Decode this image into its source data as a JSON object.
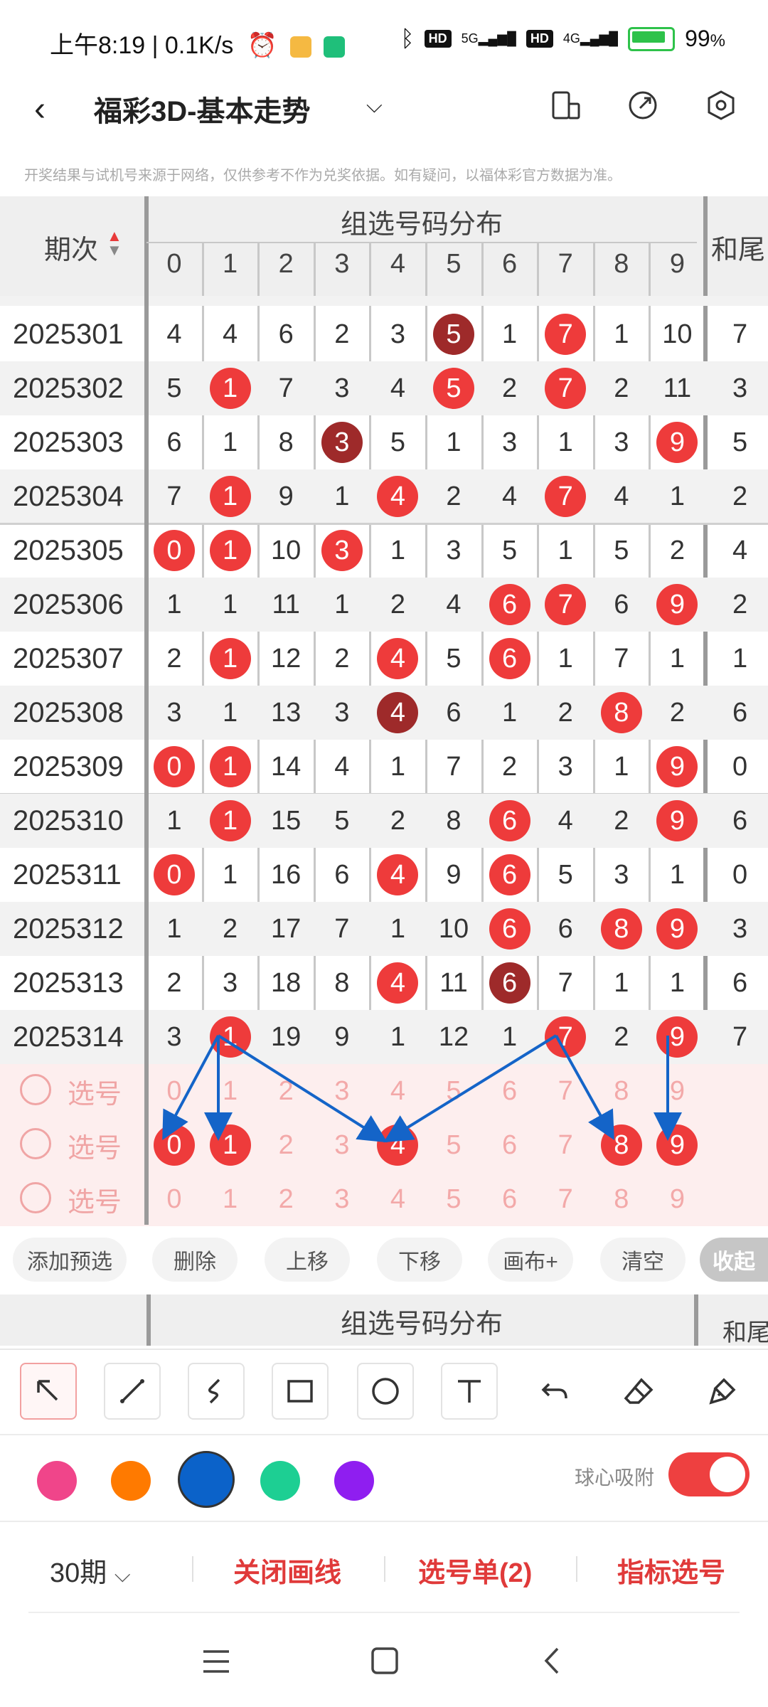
{
  "status_bar": {
    "time": "上午8:19",
    "net_speed": "0.1K/s",
    "hd1": "HD",
    "net1": "5G",
    "hd2": "HD",
    "net2": "4G",
    "battery": "99",
    "battery_unit": "%"
  },
  "header": {
    "title": "福彩3D-基本走势"
  },
  "notice": "开奖结果与试机号来源于网络，仅供参考不作为兑奖依据。如有疑问，以福体彩官方数据为准。",
  "table": {
    "period_header": "期次",
    "group_header": "组选号码分布",
    "sum_header": "和尾",
    "digits": [
      "0",
      "1",
      "2",
      "3",
      "4",
      "5",
      "6",
      "7",
      "8",
      "9"
    ],
    "rows": [
      {
        "period": "2025301",
        "cells": [
          "4",
          "4",
          "6",
          "2",
          "3",
          "5",
          "1",
          "7",
          "1",
          "10"
        ],
        "balls": [
          5,
          7
        ],
        "dark": [
          5
        ],
        "sum": "7"
      },
      {
        "period": "2025302",
        "cells": [
          "5",
          "1",
          "7",
          "3",
          "4",
          "5",
          "2",
          "7",
          "2",
          "11"
        ],
        "balls": [
          1,
          5,
          7
        ],
        "dark": [],
        "sum": "3"
      },
      {
        "period": "2025303",
        "cells": [
          "6",
          "1",
          "8",
          "3",
          "5",
          "1",
          "3",
          "1",
          "3",
          "9"
        ],
        "balls": [
          3,
          9
        ],
        "dark": [
          3
        ],
        "sum": "5"
      },
      {
        "period": "2025304",
        "cells": [
          "7",
          "1",
          "9",
          "1",
          "4",
          "2",
          "4",
          "7",
          "4",
          "1"
        ],
        "balls": [
          1,
          4,
          7
        ],
        "dark": [],
        "sum": "2"
      },
      {
        "period": "2025305",
        "cells": [
          "0",
          "1",
          "10",
          "3",
          "1",
          "3",
          "5",
          "1",
          "5",
          "2"
        ],
        "balls": [
          0,
          1,
          3
        ],
        "dark": [],
        "sum": "4"
      },
      {
        "period": "2025306",
        "cells": [
          "1",
          "1",
          "11",
          "1",
          "2",
          "4",
          "6",
          "7",
          "6",
          "9"
        ],
        "balls": [
          6,
          7,
          9
        ],
        "dark": [],
        "sum": "2"
      },
      {
        "period": "2025307",
        "cells": [
          "2",
          "1",
          "12",
          "2",
          "4",
          "5",
          "6",
          "1",
          "7",
          "1"
        ],
        "balls": [
          1,
          4,
          6
        ],
        "dark": [],
        "sum": "1"
      },
      {
        "period": "2025308",
        "cells": [
          "3",
          "1",
          "13",
          "3",
          "4",
          "6",
          "1",
          "2",
          "8",
          "2"
        ],
        "balls": [
          4,
          8
        ],
        "dark": [
          4
        ],
        "sum": "6"
      },
      {
        "period": "2025309",
        "cells": [
          "0",
          "1",
          "14",
          "4",
          "1",
          "7",
          "2",
          "3",
          "1",
          "9"
        ],
        "balls": [
          0,
          1,
          9
        ],
        "dark": [],
        "sum": "0"
      },
      {
        "period": "2025310",
        "cells": [
          "1",
          "1",
          "15",
          "5",
          "2",
          "8",
          "6",
          "4",
          "2",
          "9"
        ],
        "balls": [
          1,
          6,
          9
        ],
        "dark": [],
        "sum": "6"
      },
      {
        "period": "2025311",
        "cells": [
          "0",
          "1",
          "16",
          "6",
          "4",
          "9",
          "6",
          "5",
          "3",
          "1"
        ],
        "balls": [
          0,
          4,
          6
        ],
        "dark": [],
        "sum": "0"
      },
      {
        "period": "2025312",
        "cells": [
          "1",
          "2",
          "17",
          "7",
          "1",
          "10",
          "6",
          "6",
          "8",
          "9"
        ],
        "balls": [
          6,
          8,
          9
        ],
        "dark": [],
        "sum": "3"
      },
      {
        "period": "2025313",
        "cells": [
          "2",
          "3",
          "18",
          "8",
          "4",
          "11",
          "6",
          "7",
          "1",
          "1"
        ],
        "balls": [
          4,
          6
        ],
        "dark": [
          6
        ],
        "sum": "6"
      },
      {
        "period": "2025314",
        "cells": [
          "3",
          "1",
          "19",
          "9",
          "1",
          "12",
          "1",
          "7",
          "2",
          "9"
        ],
        "balls": [
          1,
          7,
          9
        ],
        "dark": [],
        "sum": "7"
      }
    ],
    "select_rows": [
      {
        "label": "选号",
        "balls": []
      },
      {
        "label": "选号",
        "balls": [
          0,
          1,
          4,
          8,
          9
        ]
      },
      {
        "label": "选号",
        "balls": []
      }
    ]
  },
  "actions": {
    "add": "添加预选",
    "delete": "删除",
    "up": "上移",
    "down": "下移",
    "canvas": "画布+",
    "clear": "清空",
    "collapse": "收起"
  },
  "second_header": {
    "group_header": "组选号码分布",
    "sum_header": "和尾"
  },
  "tools": [
    "pointer-tool",
    "line-tool",
    "curve-tool",
    "rect-tool",
    "circle-tool",
    "text-tool",
    "undo-tool",
    "eraser-tool",
    "brush-clear-tool"
  ],
  "colors": {
    "swatches": [
      "#f0458a",
      "#ff7a00",
      "#0b62c9",
      "#1dcf93",
      "#8f1ef0"
    ],
    "selected": "#0b62c9",
    "ball_red": "#ee3b3b",
    "ball_dark": "#9e2a2a",
    "accent": "#e03a3a"
  },
  "magnet": {
    "label": "球心吸附",
    "on": true
  },
  "bottom": {
    "period": "30期",
    "close_draw": "关闭画线",
    "ticket": "选号单(2)",
    "indicator": "指标选号"
  }
}
